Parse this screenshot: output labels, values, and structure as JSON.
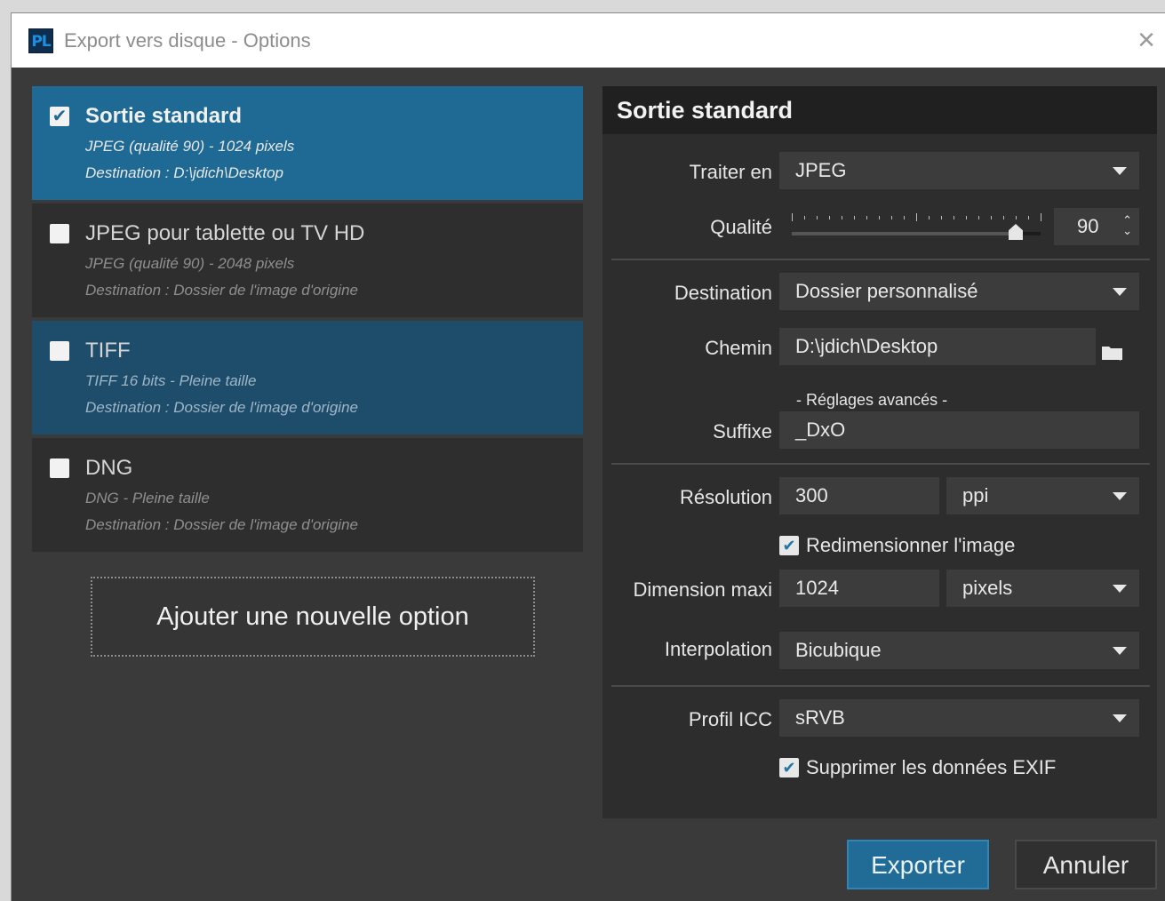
{
  "window": {
    "app_icon": "PL",
    "title": "Export vers disque - Options",
    "close_icon": "×"
  },
  "presets": [
    {
      "name": "Sortie standard",
      "checked": true,
      "line1": "JPEG (qualité 90)  -  1024 pixels",
      "line2": "Destination : D:\\jdich\\Desktop"
    },
    {
      "name": "JPEG pour tablette ou TV HD",
      "checked": false,
      "line1": "JPEG (qualité 90)  -  2048 pixels",
      "line2": "Destination : Dossier de l'image d'origine"
    },
    {
      "name": "TIFF",
      "checked": false,
      "line1": "TIFF 16 bits  -  Pleine taille",
      "line2": "Destination : Dossier de l'image d'origine"
    },
    {
      "name": "DNG",
      "checked": false,
      "line1": "DNG  -  Pleine taille",
      "line2": "Destination : Dossier de l'image d'origine"
    }
  ],
  "add_option_label": "Ajouter une nouvelle option",
  "panel": {
    "title": "Sortie standard",
    "format_label": "Traiter en",
    "format_value": "JPEG",
    "quality_label": "Qualité",
    "quality_value": "90",
    "quality_fraction": 0.9,
    "destination_label": "Destination",
    "destination_value": "Dossier personnalisé",
    "path_label": "Chemin",
    "path_value": "D:\\jdich\\Desktop",
    "advanced_label": "- Réglages avancés -",
    "suffix_label": "Suffixe",
    "suffix_value": "_DxO",
    "resolution_label": "Résolution",
    "resolution_value": "300",
    "resolution_unit": "ppi",
    "resize_label": "Redimensionner l'image",
    "resize_checked": true,
    "max_dim_label": "Dimension maxi",
    "max_dim_value": "1024",
    "max_dim_unit": "pixels",
    "interpolation_label": "Interpolation",
    "interpolation_value": "Bicubique",
    "icc_label": "Profil ICC",
    "icc_value": "sRVB",
    "exif_label": "Supprimer les données EXIF",
    "exif_checked": true
  },
  "buttons": {
    "export": "Exporter",
    "cancel": "Annuler"
  },
  "colors": {
    "accent": "#1f6a95",
    "background": "#3a3a3a",
    "panel": "#2d2d2d"
  }
}
